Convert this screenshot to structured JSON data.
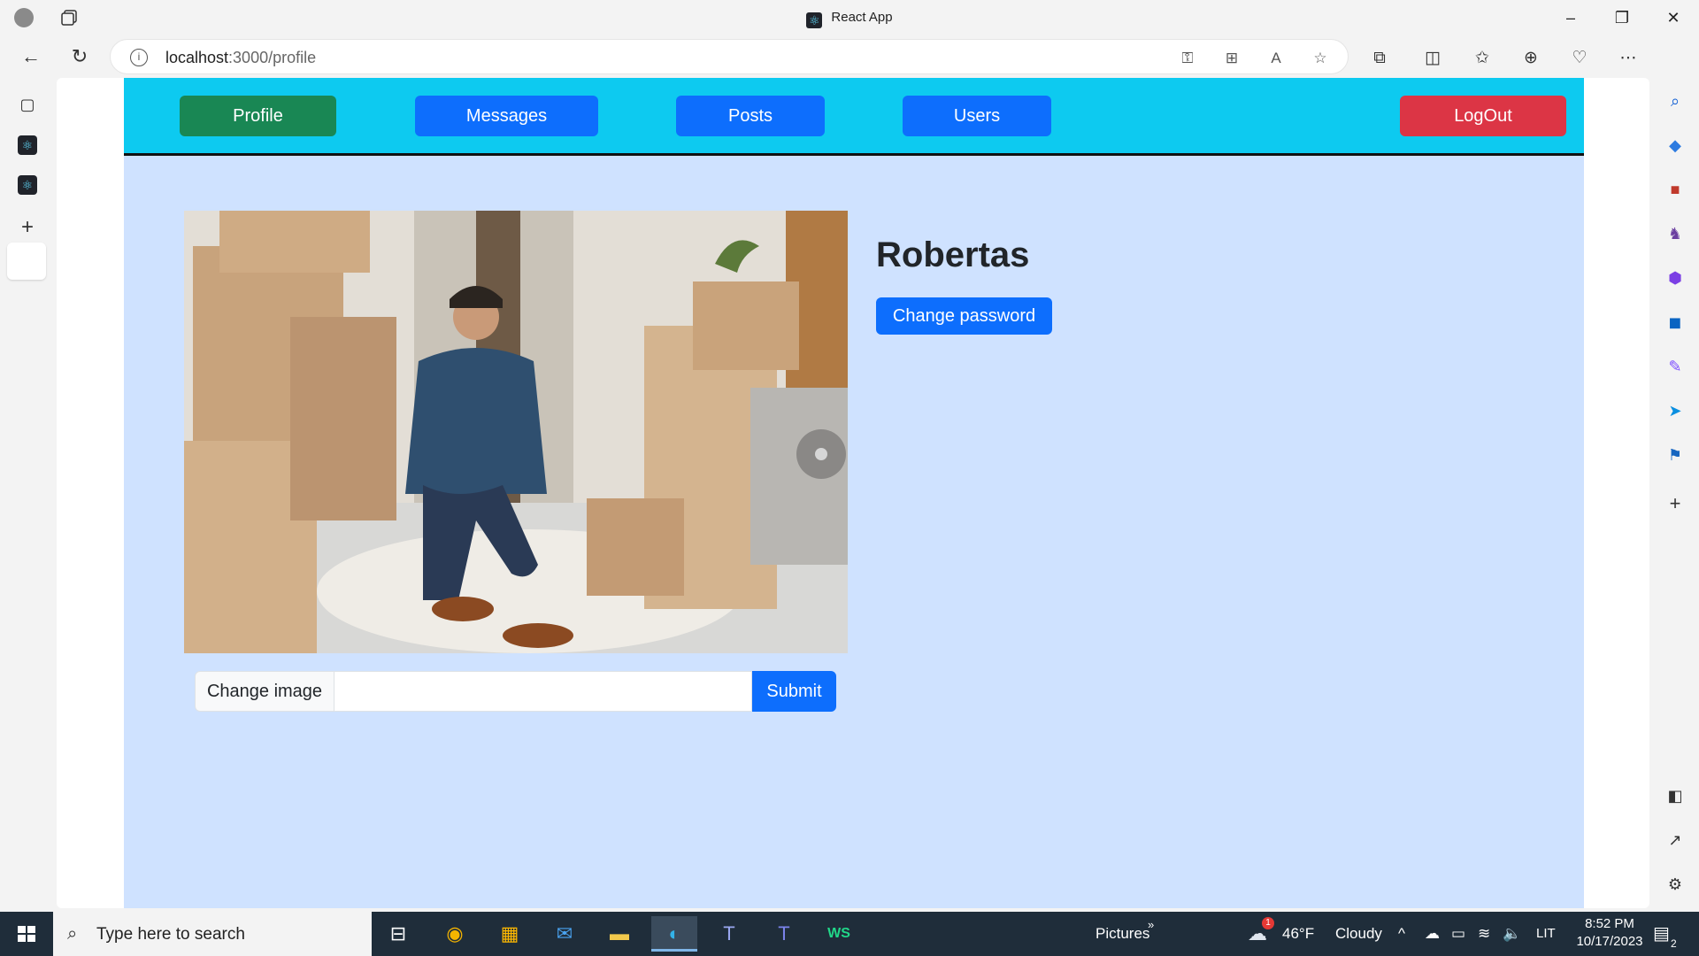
{
  "browser": {
    "window_title": "React App",
    "url_host": "localhost",
    "url_path": ":3000/profile"
  },
  "navbar": {
    "profile_label": "Profile",
    "messages_label": "Messages",
    "posts_label": "Posts",
    "users_label": "Users",
    "logout_label": "LogOut"
  },
  "profile": {
    "username": "Robertas",
    "change_password_label": "Change password",
    "change_image_label": "Change image",
    "submit_label": "Submit"
  },
  "taskbar": {
    "search_placeholder": "Type here to search",
    "pictures_label": "Pictures",
    "weather_temp": "46°F",
    "weather_desc": "Cloudy",
    "weather_badge": "1",
    "lang": "LIT",
    "time": "8:52 PM",
    "date": "10/17/2023",
    "notif_count": "2"
  },
  "colors": {
    "navbar_bg": "#0dcaf0",
    "page_bg": "#cfe2ff",
    "primary": "#0d6efd",
    "success": "#198754",
    "danger": "#dc3545"
  }
}
